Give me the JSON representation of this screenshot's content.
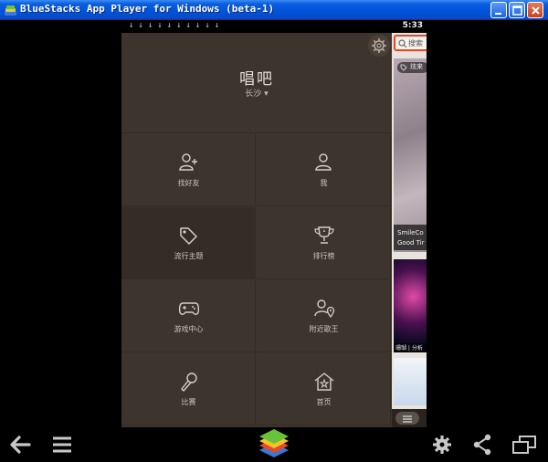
{
  "window": {
    "title": "BlueStacks App Player for Windows (beta-1)"
  },
  "status_bar": {
    "time": "5:33",
    "download_icons": "↓↓↓↓↓↓↓↓↓↓"
  },
  "drawer": {
    "brand": "唱吧",
    "city": "长沙 ▾",
    "items": [
      {
        "label": "找好友",
        "icon": "add-user-icon"
      },
      {
        "label": "我",
        "icon": "user-icon"
      },
      {
        "label": "流行主题",
        "icon": "tag-icon"
      },
      {
        "label": "排行榜",
        "icon": "trophy-icon"
      },
      {
        "label": "游戏中心",
        "icon": "gamepad-icon"
      },
      {
        "label": "附近歌王",
        "icon": "nearby-user-icon"
      },
      {
        "label": "比赛",
        "icon": "microphone-icon"
      },
      {
        "label": "首页",
        "icon": "home-icon"
      }
    ]
  },
  "peek": {
    "search_text": "搜索",
    "tag": "炫来",
    "caption_line1": "SmileCo",
    "caption_line2": "Good Tir",
    "card2_caption": "珊瑚 | 分析"
  },
  "colors": {
    "drawer_bg": "#3d342d",
    "titlebar_blue": "#0053d8",
    "accent_red": "#e04a2a"
  }
}
